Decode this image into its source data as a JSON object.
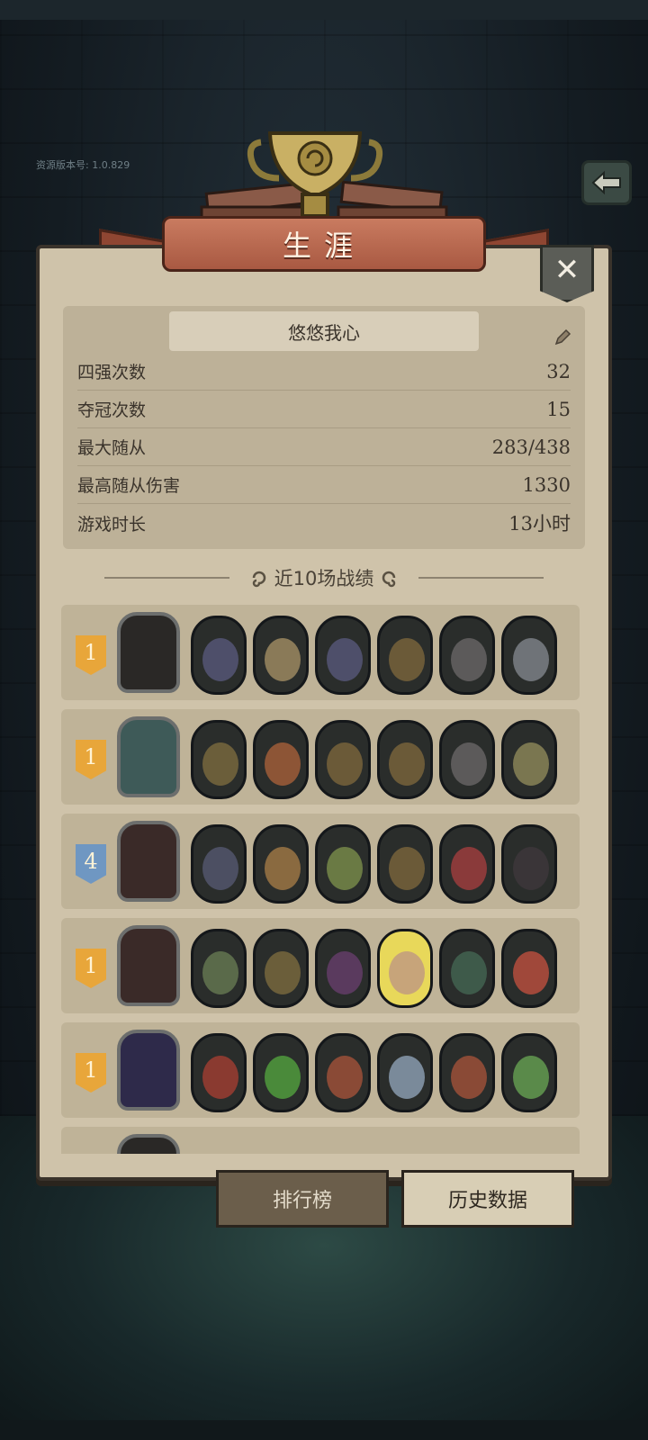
{
  "version_label": "资源版本号: 1.0.829",
  "title": "生涯",
  "profile": {
    "nickname": "悠悠我心",
    "stats": [
      {
        "label": "四强次数",
        "value": "32"
      },
      {
        "label": "夺冠次数",
        "value": "15"
      },
      {
        "label": "最大随从",
        "value": "283/438"
      },
      {
        "label": "最高随从伤害",
        "value": "1330"
      },
      {
        "label": "游戏时长",
        "value": "13小时"
      }
    ]
  },
  "recent_header": "近10场战绩",
  "matches": [
    {
      "rank": "1",
      "rank_color": "gold"
    },
    {
      "rank": "1",
      "rank_color": "gold"
    },
    {
      "rank": "4",
      "rank_color": "blue"
    },
    {
      "rank": "1",
      "rank_color": "gold"
    },
    {
      "rank": "1",
      "rank_color": "gold"
    }
  ],
  "tabs": {
    "leaderboard": "排行榜",
    "history": "历史数据"
  },
  "colors": {
    "panel": "#cfc3aa",
    "banner": "#c97b60",
    "rank_gold": "#e8a63a",
    "rank_blue": "#6f97c2"
  }
}
